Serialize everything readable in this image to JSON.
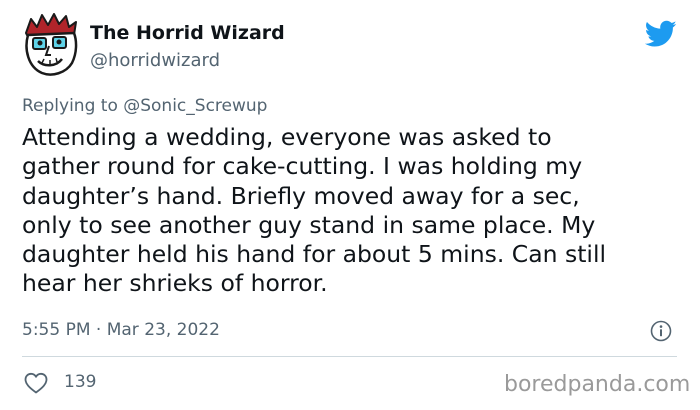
{
  "author": {
    "display_name": "The Horrid Wizard",
    "handle": "@horridwizard",
    "avatar_icon": "cartoon-face-avatar"
  },
  "platform_icon": "twitter-bird-icon",
  "reply": {
    "text": "Replying to @Sonic_Screwup"
  },
  "tweet": {
    "text": "Attending a wedding, everyone was asked to\ngather round for cake-cutting. I was holding my\ndaughter’s hand. Briefly moved away for a sec,\nonly to see another guy stand in same place. My\ndaughter held his hand for about 5 mins. Can still\nhear her shrieks of horror."
  },
  "meta": {
    "timestamp": "5:55 PM · Mar 23, 2022",
    "info_icon": "info-icon"
  },
  "actions": {
    "like_icon": "heart-icon",
    "like_count": "139"
  },
  "watermark": "boredpanda.com",
  "colors": {
    "twitter_blue": "#1d9bf0",
    "secondary_text": "#536471",
    "primary_text": "#0f1419",
    "avatar_cyan": "#5fd3e8",
    "avatar_hair": "#b0242a"
  }
}
